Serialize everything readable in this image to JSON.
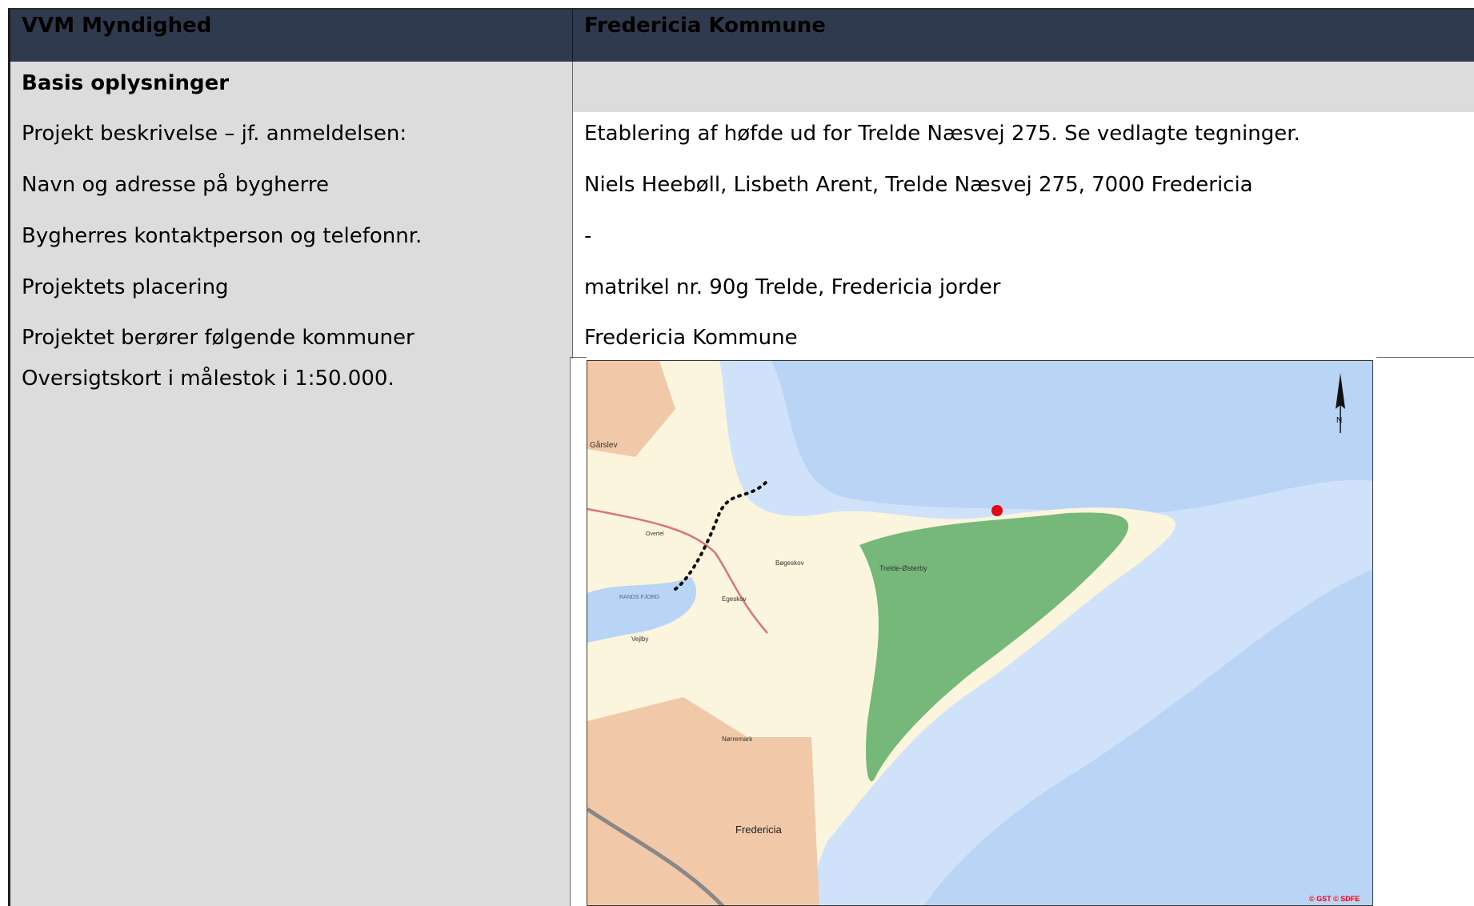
{
  "header": {
    "left": "VVM Myndighed",
    "right": "Fredericia Kommune"
  },
  "section": {
    "title": "Basis oplysninger"
  },
  "rows": [
    {
      "label": "Projekt beskrivelse – jf. anmeldelsen:",
      "value": "Etablering af høfde ud for Trelde Næsvej 275. Se vedlagte tegninger."
    },
    {
      "label": "Navn og adresse på bygherre",
      "value": "Niels Heebøll, Lisbeth Arent, Trelde Næsvej 275, 7000 Fredericia"
    },
    {
      "label": "Bygherres kontaktperson og telefonnr.",
      "value": "-"
    },
    {
      "label": "Projektets placering",
      "value": "matrikel nr. 90g Trelde, Fredericia jorder"
    },
    {
      "label": "Projektet berører følgende kommuner",
      "value": "Fredericia Kommune"
    }
  ],
  "overview": {
    "label": "Oversigtskort i målestok i 1:50.000.",
    "map": {
      "place_labels": [
        "Gårslev",
        "Fredericia",
        "Trelde-Østerby",
        "Egeskov",
        "Bøgeskov",
        "Nørremark",
        "Vejlby",
        "RANDS FJORD",
        "Overtel"
      ],
      "north_label": "N",
      "copyright": "© GST © SDFE",
      "colors": {
        "sea": "#b9d4f4",
        "shallow": "#d6e6fb",
        "land": "#fbf5dd",
        "forest": "#76b879",
        "urban": "#f1c9a8",
        "marker": "#e30613"
      }
    }
  }
}
